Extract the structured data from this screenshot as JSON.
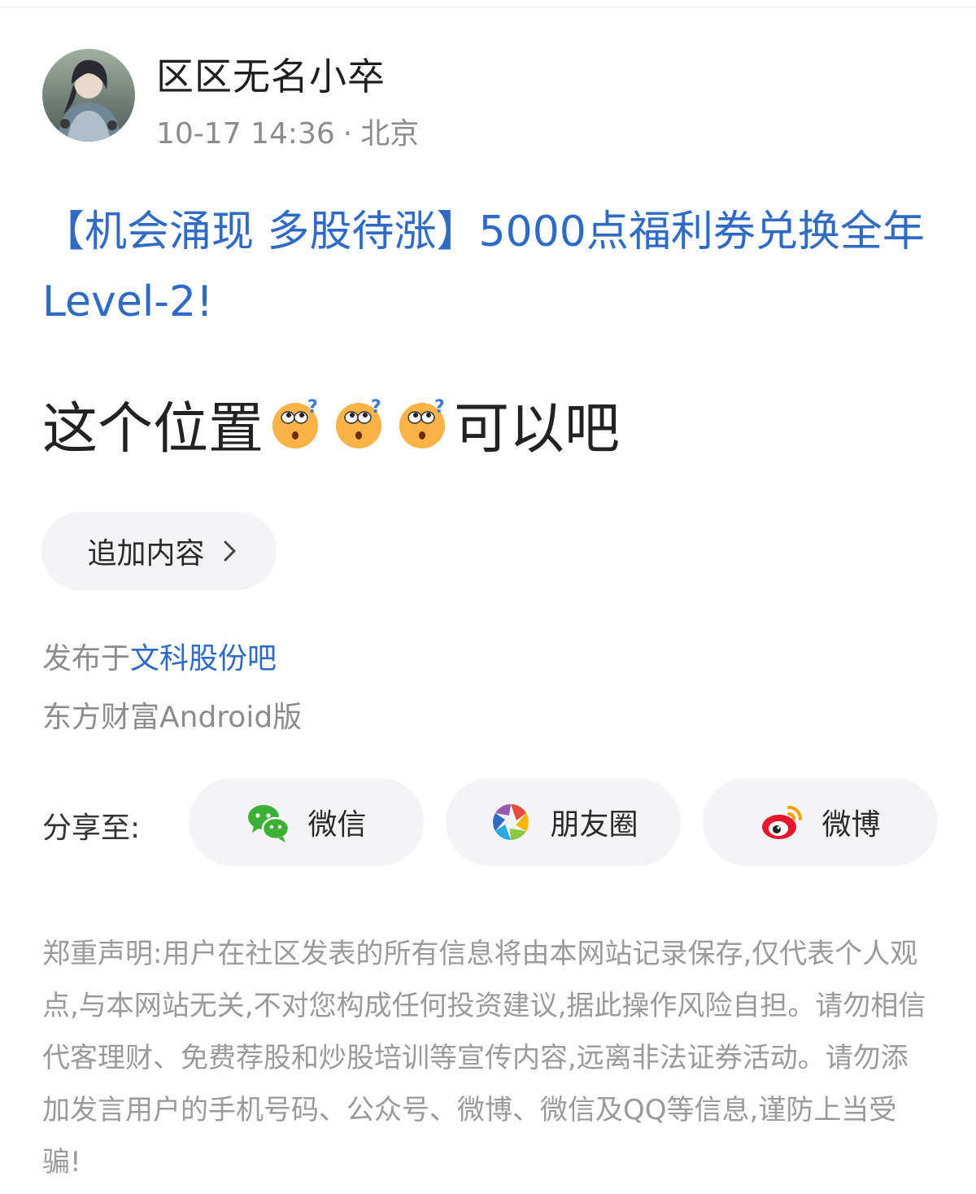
{
  "post": {
    "author": {
      "name": "区区无名小卒",
      "avatar": "user-avatar"
    },
    "timestamp": "10-17 14:36",
    "separator": "·",
    "location": "北京",
    "promo_title": "【机会涌现 多股待涨】5000点福利券兑换全年Level-2!",
    "content": {
      "text_before": "这个位置",
      "emoji_icons": [
        "thinking-face-icon",
        "thinking-face-icon",
        "thinking-face-icon"
      ],
      "text_after": "可以吧"
    },
    "append_button": {
      "label": "追加内容",
      "icon": "chevron-right-icon"
    },
    "posted_in": {
      "prefix": "发布于",
      "board": "文科股份吧"
    },
    "client": "东方财富Android版"
  },
  "share": {
    "label": "分享至:",
    "targets": [
      {
        "label": "微信",
        "icon": "wechat-icon"
      },
      {
        "label": "朋友圈",
        "icon": "moments-icon"
      },
      {
        "label": "微博",
        "icon": "weibo-icon"
      }
    ]
  },
  "disclaimer": "郑重声明:用户在社区发表的所有信息将由本网站记录保存,仅代表个人观点,与本网站无关,不对您构成任何投资建议,据此操作风险自担。请勿相信代客理财、免费荐股和炒股培训等宣传内容,远离非法证券活动。请勿添加发言用户的手机号码、公众号、微博、微信及QQ等信息,谨防上当受骗!",
  "colors": {
    "link_blue": "#2f6ac4",
    "muted_gray": "#8c8c8c",
    "pill_background": "#f4f4f6",
    "wechat_green": "#3cb034",
    "weibo_red": "#e6162d",
    "weibo_orange": "#f6a000"
  }
}
